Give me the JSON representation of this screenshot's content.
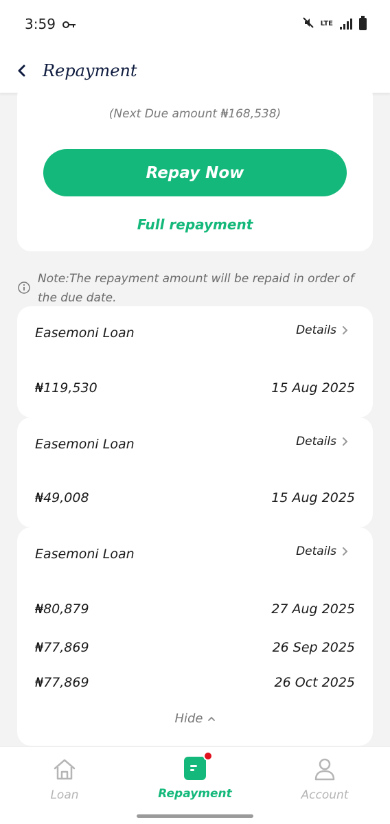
{
  "status_bar": {
    "time": "3:59",
    "network": "LTE"
  },
  "header": {
    "title": "Repayment"
  },
  "summary": {
    "next_due": "(Next Due amount ₦168,538)",
    "repay_button": "Repay Now",
    "full_repayment": "Full repayment"
  },
  "note": "Note:The repayment amount will be repaid in order of the due date.",
  "loans": [
    {
      "title": "Easemoni Loan",
      "details_label": "Details",
      "installments": [
        {
          "amount": "₦119,530",
          "date": "15 Aug 2025"
        }
      ]
    },
    {
      "title": "Easemoni Loan",
      "details_label": "Details",
      "installments": [
        {
          "amount": "₦49,008",
          "date": "15 Aug 2025"
        }
      ]
    },
    {
      "title": "Easemoni Loan",
      "details_label": "Details",
      "installments": [
        {
          "amount": "₦80,879",
          "date": "27 Aug 2025"
        },
        {
          "amount": "₦77,869",
          "date": "26 Sep 2025"
        },
        {
          "amount": "₦77,869",
          "date": "26 Oct 2025"
        }
      ],
      "toggle_label": "Hide"
    }
  ],
  "bottom_nav": {
    "items": [
      {
        "label": "Loan",
        "icon": "house-icon",
        "active": false
      },
      {
        "label": "Repayment",
        "icon": "repayment-icon",
        "active": true
      },
      {
        "label": "Account",
        "icon": "person-icon",
        "active": false
      }
    ]
  },
  "colors": {
    "accent": "#13b87a",
    "badge": "#e0121e",
    "title": "#0f1c3f"
  }
}
